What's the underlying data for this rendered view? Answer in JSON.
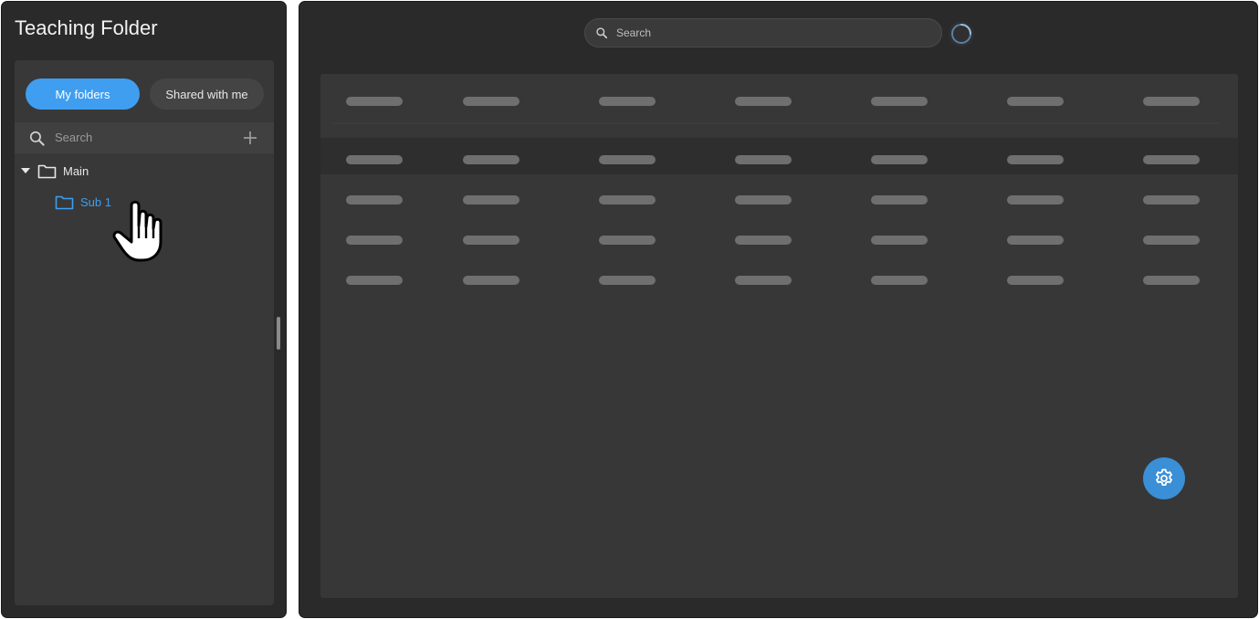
{
  "sidebar": {
    "title": "Teaching Folder",
    "tabs": [
      {
        "label": "My folders",
        "active": true
      },
      {
        "label": "Shared with me",
        "active": false
      }
    ],
    "search": {
      "placeholder": "Search"
    },
    "tree": [
      {
        "label": "Main",
        "expanded": true,
        "icon": "folder-icon"
      },
      {
        "label": "Sub 1",
        "selected": true,
        "icon": "folder-icon"
      }
    ]
  },
  "main": {
    "search": {
      "placeholder": "Search"
    },
    "table": {
      "loading": true,
      "header_rows": 1,
      "body_rows": 4,
      "columns": 7,
      "highlighted_row": 1
    }
  },
  "icons": {
    "search": "search-icon",
    "add": "plus-icon",
    "expand": "caret-down-icon",
    "folder": "folder-icon",
    "spinner": "loading-spinner-icon",
    "settings": "gear-icon",
    "pointer": "hand-pointer-icon"
  },
  "colors": {
    "accent": "#3f9ef0",
    "fab": "#3a8fd6",
    "panel": "#2a2a2a",
    "card": "#383838",
    "skeleton": "#6f6f6f"
  }
}
